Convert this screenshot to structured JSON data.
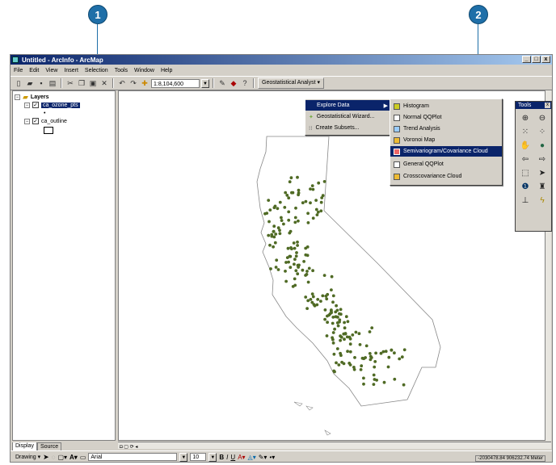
{
  "callouts": [
    {
      "number": "1"
    },
    {
      "number": "2"
    }
  ],
  "window": {
    "title": "Untitled - ArcInfo - ArcMap",
    "controls": [
      "_",
      "□",
      "x"
    ]
  },
  "menubar": [
    "File",
    "Edit",
    "View",
    "Insert",
    "Selection",
    "Tools",
    "Window",
    "Help"
  ],
  "toolbar": {
    "scale": "1:8,104,600",
    "geostat_menu": "Geostatistical Analyst ▾"
  },
  "toc": {
    "root": "Layers",
    "layers": [
      {
        "name": "ca_ozone_pts",
        "checked": true,
        "selected": true
      },
      {
        "name": "ca_outline",
        "checked": true,
        "selected": false
      }
    ],
    "tabs": [
      "Display",
      "Source"
    ]
  },
  "geostat_menu": {
    "items": [
      {
        "label": "Explore Data",
        "highlighted": true
      },
      {
        "label": "Geostatistical Wizard...",
        "highlighted": false
      },
      {
        "label": "Create Subsets...",
        "highlighted": false
      }
    ]
  },
  "explore_submenu": {
    "items": [
      {
        "label": "Histogram",
        "icon": "histogram-icon",
        "highlighted": false
      },
      {
        "label": "Normal QQPlot",
        "icon": "qqplot-icon",
        "highlighted": false
      },
      {
        "label": "Trend Analysis",
        "icon": "trend-icon",
        "highlighted": false
      },
      {
        "label": "Voronoi Map",
        "icon": "voronoi-icon",
        "highlighted": false
      },
      {
        "label": "Semivariogram/Covariance Cloud",
        "icon": "semivariogram-icon",
        "highlighted": true
      },
      {
        "label": "General QQPlot",
        "icon": "general-qqplot-icon",
        "highlighted": false
      },
      {
        "label": "Crosscovariance Cloud",
        "icon": "crosscov-icon",
        "highlighted": false
      }
    ]
  },
  "tools_palette": {
    "title": "Tools",
    "close": "x"
  },
  "drawbar": {
    "label": "Drawing ▾",
    "font": "Arial",
    "size": "10"
  },
  "status": {
    "coords": "-2030478.84  906232.74 Meter"
  },
  "colors": {
    "points": "#4f6a24",
    "highlight": "#0a246a",
    "callout": "#1f6fa8"
  }
}
